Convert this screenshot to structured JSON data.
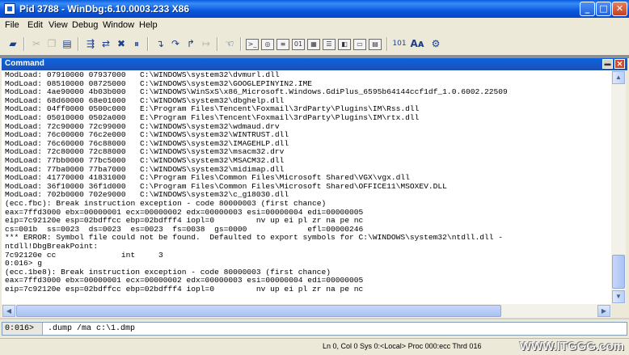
{
  "window": {
    "title": "Pid 3788 - WinDbg:6.10.0003.233 X86"
  },
  "menu": [
    "File",
    "Edit",
    "View",
    "Debug",
    "Window",
    "Help"
  ],
  "toolbar_icons": [
    "open-icon",
    "cut-icon",
    "copy-icon",
    "paste-icon",
    "go-icon",
    "restart-icon",
    "stop-debugging-icon",
    "break-icon",
    "step-into-icon",
    "step-over-icon",
    "step-out-icon",
    "run-to-cursor-icon",
    "hand-icon",
    "command-window-icon",
    "watch-window-icon",
    "locals-window-icon",
    "registers-window-icon",
    "memory-window-icon",
    "call-stack-window-icon",
    "disassembly-window-icon",
    "scratch-pad-icon",
    "source-mode-icon",
    "font-icon",
    "options-icon"
  ],
  "command_window": {
    "title": "Command",
    "lines": [
      "ModLoad: 07910000 07937000   C:\\WINDOWS\\system32\\dvmurl.dll",
      "ModLoad: 08510000 08725000   C:\\WINDOWS\\system32\\GOOGLEPINYIN2.IME",
      "ModLoad: 4ae90000 4b03b000   C:\\WINDOWS\\WinSxS\\x86_Microsoft.Windows.GdiPlus_6595b64144ccf1df_1.0.6002.22509",
      "ModLoad: 68d60000 68e01000   C:\\WINDOWS\\system32\\dbghelp.dll",
      "ModLoad: 04ff0000 0500c000   E:\\Program Files\\Tencent\\Foxmail\\3rdParty\\Plugins\\IM\\Rss.dll",
      "ModLoad: 05010000 0502a000   E:\\Program Files\\Tencent\\Foxmail\\3rdParty\\Plugins\\IM\\rtx.dll",
      "ModLoad: 72c90000 72c99000   C:\\WINDOWS\\system32\\wdmaud.drv",
      "ModLoad: 76c00000 76c2e000   C:\\WINDOWS\\system32\\WINTRUST.dll",
      "ModLoad: 76c60000 76c88000   C:\\WINDOWS\\system32\\IMAGEHLP.dll",
      "ModLoad: 72c80000 72c88000   C:\\WINDOWS\\system32\\msacm32.drv",
      "ModLoad: 77bb0000 77bc5000   C:\\WINDOWS\\system32\\MSACM32.dll",
      "ModLoad: 77ba0000 77ba7000   C:\\WINDOWS\\system32\\midimap.dll",
      "ModLoad: 41770000 41831000   C:\\Program Files\\Common Files\\Microsoft Shared\\VGX\\vgx.dll",
      "ModLoad: 36f10000 36f1d000   C:\\Program Files\\Common Files\\Microsoft Shared\\OFFICE11\\MSOXEV.DLL",
      "ModLoad: 702b0000 702e9000   C:\\WINDOWS\\system32\\c_g18030.dll",
      "(ecc.fbc): Break instruction exception - code 80000003 (first chance)",
      "eax=7ffd3000 ebx=00000001 ecx=00000002 edx=00000003 esi=00000004 edi=00000005",
      "eip=7c92120e esp=02bdffcc ebp=02bdfff4 iopl=0         nv up ei pl zr na pe nc",
      "cs=001b  ss=0023  ds=0023  es=0023  fs=0038  gs=0000             efl=00000246",
      "*** ERROR: Symbol file could not be found.  Defaulted to export symbols for C:\\WINDOWS\\system32\\ntdll.dll -",
      "ntdll!DbgBreakPoint:",
      "7c92120e cc              int     3",
      "0:016> g",
      "(ecc.1be8): Break instruction exception - code 80000003 (first chance)",
      "eax=7ffd3000 ebx=00000001 ecx=00000002 edx=00000003 esi=00000004 edi=00000005",
      "eip=7c92120e esp=02bdffcc ebp=02bdfff4 iopl=0         nv up ei pl zr na pe nc"
    ]
  },
  "prompt": {
    "label": "0:016>",
    "value": ".dump /ma c:\\1.dmp"
  },
  "statusbar": {
    "text": "Ln 0, Col 0  Sys 0:<Local>  Proc 000:ecc  Thrd 016",
    "watermark": "WWW.ITGGG.com"
  }
}
